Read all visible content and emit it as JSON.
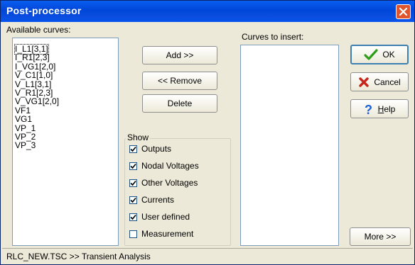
{
  "window": {
    "title": "Post-processor"
  },
  "available": {
    "label": "Available curves:",
    "items": [
      "I_L1[3,1]",
      "I_R1[2,3]",
      "I_VG1[2,0]",
      "V_C1[1,0]",
      "V_L1[3,1]",
      "V_R1[2,3]",
      "V_VG1[2,0]",
      "VF1",
      "VG1",
      "VP_1",
      "VP_2",
      "VP_3"
    ],
    "selected_index": 0
  },
  "actions": {
    "add": "Add >>",
    "remove": "<< Remove",
    "delete": "Delete"
  },
  "show": {
    "title": "Show",
    "options": [
      {
        "label": "Outputs",
        "checked": true
      },
      {
        "label": "Nodal Voltages",
        "checked": true
      },
      {
        "label": "Other Voltages",
        "checked": true
      },
      {
        "label": "Currents",
        "checked": true
      },
      {
        "label": "User defined",
        "checked": true
      },
      {
        "label": "Measurement",
        "checked": false
      }
    ]
  },
  "insert": {
    "label": "Curves to insert:"
  },
  "buttons": {
    "ok": "OK",
    "cancel": "Cancel",
    "help": "Help",
    "more": "More >>"
  },
  "status": "RLC_NEW.TSC >> Transient Analysis",
  "colors": {
    "titlebar": "#0a5ff0",
    "ok_icon": "#2e9e1a",
    "cancel_icon": "#c8251a",
    "help_icon": "#1e5fd8"
  }
}
